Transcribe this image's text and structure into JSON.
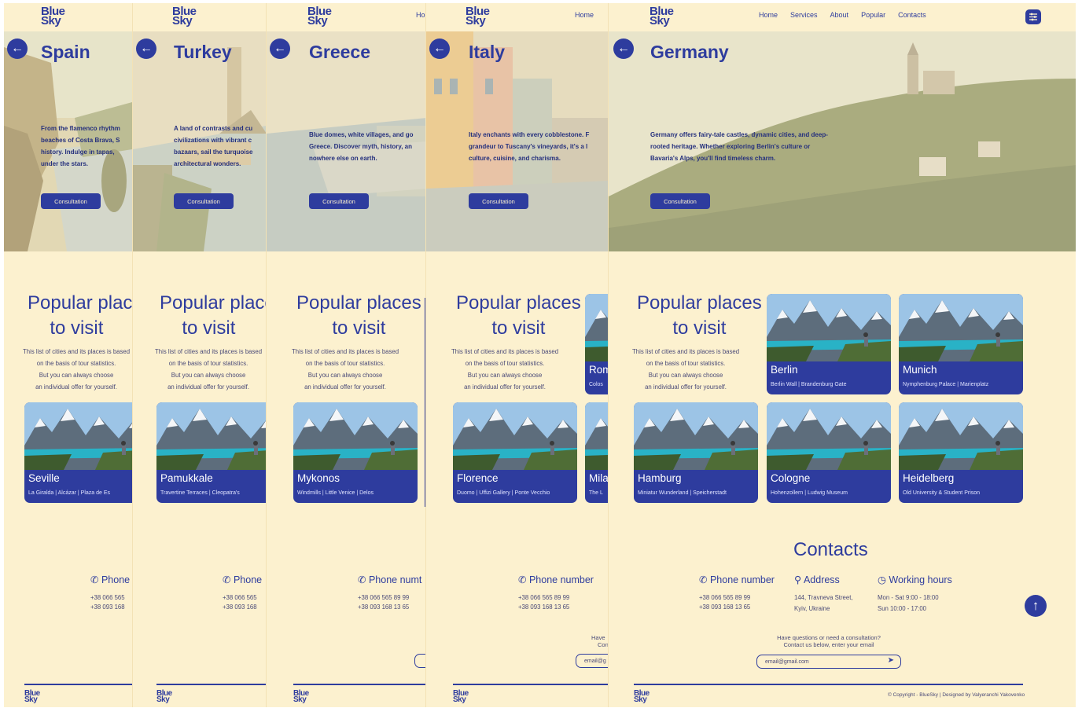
{
  "brand": {
    "line1": "Blue",
    "line2": "Sky",
    "primary_color": "#2e3c9e",
    "background_color": "#fcf1cf"
  },
  "nav": {
    "items": [
      "Home",
      "Services",
      "About",
      "Popular",
      "Contacts"
    ],
    "settings_icon": "sliders-icon"
  },
  "hero_panels": [
    {
      "title": "Spain",
      "text": "From the flamenco rhythm\nbeaches of Costa Brava, S\nhistory. Indulge in tapas,\nunder the stars.",
      "button": "Consultation"
    },
    {
      "title": "Turkey",
      "text": "A land of contrasts and cu\ncivilizations with vibrant c\nbazaars, sail the turquoise\narchitectural wonders.",
      "button": "Consultation"
    },
    {
      "title": "Greece",
      "text": "Blue domes, white villages, and go\nGreece. Discover myth, history, an\nnowhere else on earth.",
      "button": "Consultation"
    },
    {
      "title": "Italy",
      "text": "Italy enchants with every cobblestone. F\ngrandeur to Tuscany's vineyards, it's a l\nculture, cuisine, and charisma.",
      "button": "Consultation"
    },
    {
      "title": "Germany",
      "text": "Germany offers fairy-tale castles, dynamic cities, and deep-\nrooted heritage. Whether exploring Berlin's culture or\nBavaria's Alps, you'll find timeless charm.",
      "button": "Consultation"
    }
  ],
  "popular": {
    "title_line1": "Popular places",
    "title_line2": "to visit",
    "desc": [
      "This list of cities and its places is based",
      "on the basis of tour statistics.",
      "But you can always choose",
      "an individual offer for yourself."
    ]
  },
  "cards": {
    "spain": [
      {
        "name": "Seville",
        "sub": "La Giralda | Alcázar | Plaza de Es"
      }
    ],
    "turkey": [
      {
        "name": "Pamukkale",
        "sub": "Travertine Terraces | Cleopatra's"
      }
    ],
    "greece": [
      {
        "name": "Mykonos",
        "sub": "Windmills | Little Venice | Delos"
      }
    ],
    "italy": [
      {
        "name": "Rom",
        "sub": "Colos"
      },
      {
        "name": "Florence",
        "sub": "Duomo | Uffizi Gallery | Ponte Vecchio"
      },
      {
        "name": "Mila",
        "sub": "The L"
      }
    ],
    "germany": [
      {
        "name": "Berlin",
        "sub": "Berlin Wall | Brandenburg Gate"
      },
      {
        "name": "Munich",
        "sub": "Nymphenburg Palace | Marienplatz"
      },
      {
        "name": "Hamburg",
        "sub": "Miniatur Wunderland | Speicherstadt"
      },
      {
        "name": "Cologne",
        "sub": "Hohenzollern | Ludwig Museum"
      },
      {
        "name": "Heidelberg",
        "sub": "Old University & Student Prison"
      }
    ]
  },
  "contacts": {
    "title": "Contacts",
    "phone_label": "Phone number",
    "phone_label_short": "Phone",
    "phone_label_cut": "Phone numt",
    "phones": [
      "+38 066 565 89 99",
      "+38 093 168 13 65"
    ],
    "phones_short": [
      "+38 066 565",
      "+38 093 168"
    ],
    "address_label": "Address",
    "address": [
      "144, Travneva Street,",
      "Kyiv, Ukraine"
    ],
    "hours_label": "Working hours",
    "hours": [
      "Mon - Sat 9:00 - 18:00",
      "Sun 10:00 - 17:00"
    ],
    "note": [
      "Have questions or need a consultation?",
      "Contact us below, enter your email"
    ],
    "note_cut": [
      "Have",
      "Con"
    ],
    "email_value": "email@gmail.com",
    "email_cut": "email@g"
  },
  "copyright": "© Copyright - BlueSky | Designed by Valyeranchi Yakovenko"
}
